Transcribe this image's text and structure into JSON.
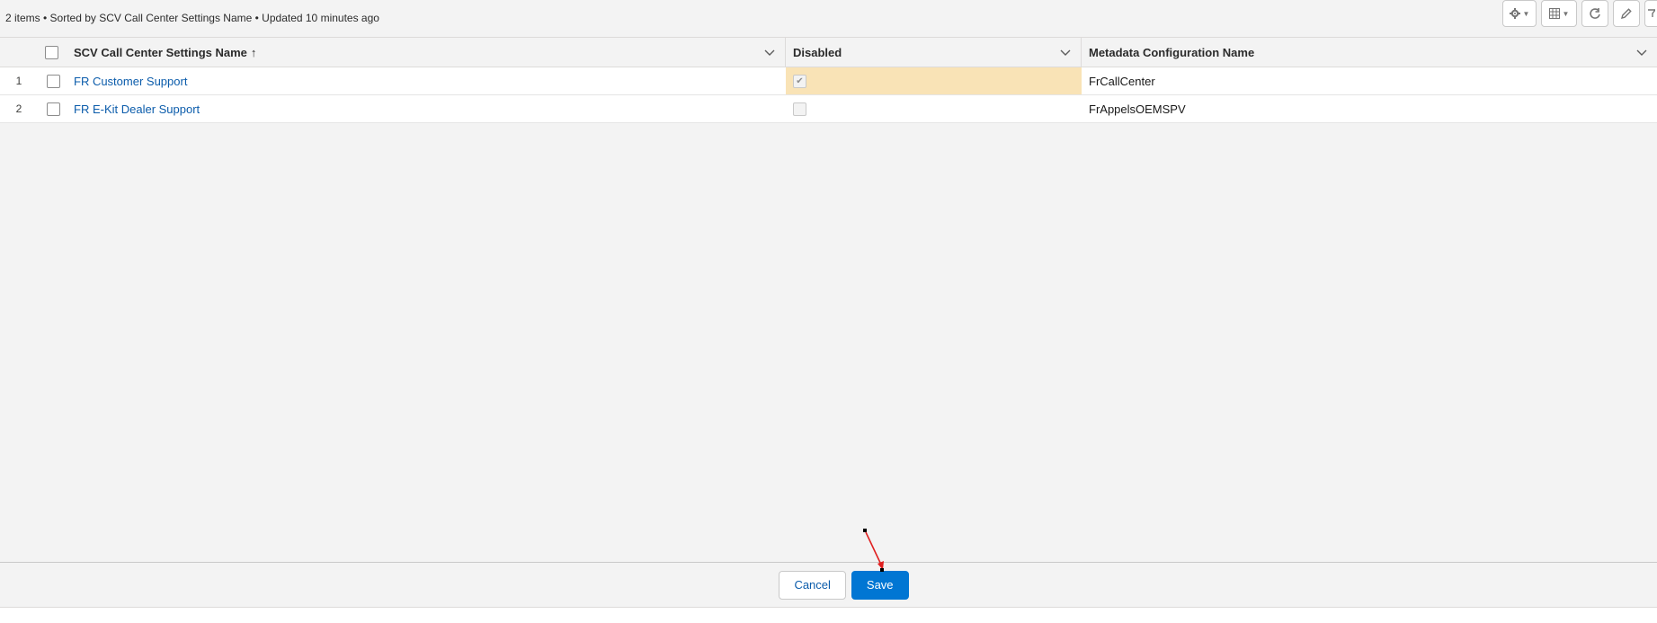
{
  "list_info": "2 items • Sorted by SCV Call Center Settings Name • Updated 10 minutes ago",
  "toolbar": {
    "icons": [
      "gear-icon",
      "table-icon",
      "refresh-icon",
      "pencil-icon",
      "filter-icon"
    ]
  },
  "grid": {
    "columns": [
      {
        "label": "SCV Call Center Settings Name",
        "sort_indicator": "↑"
      },
      {
        "label": "Disabled"
      },
      {
        "label": "Metadata Configuration Name"
      }
    ],
    "rows": [
      {
        "num": "1",
        "name": "FR Customer Support",
        "disabled": true,
        "metadata": "FrCallCenter",
        "edited": true
      },
      {
        "num": "2",
        "name": "FR E-Kit Dealer Support",
        "disabled": false,
        "metadata": "FrAppelsOEMSPV",
        "edited": false
      }
    ]
  },
  "footer": {
    "cancel_label": "Cancel",
    "save_label": "Save"
  },
  "colors": {
    "accent": "#0176d3",
    "edited_cell": "#f9e3b6",
    "link": "#0b5cab",
    "annotation_arrow": "#e02020"
  }
}
